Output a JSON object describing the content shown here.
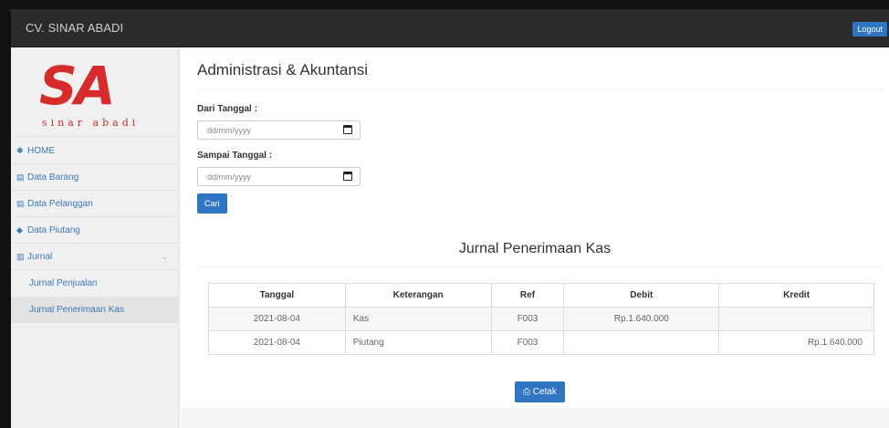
{
  "topbar": {
    "brand": "CV. SINAR ABADI",
    "logout_label": "Logout"
  },
  "logo": {
    "mark": "SA",
    "tagline": "sinar abadi"
  },
  "sidebar": {
    "items": [
      {
        "icon": "home-icon",
        "glyph": "✱",
        "label": "HOME"
      },
      {
        "icon": "document-icon",
        "glyph": "▤",
        "label": "Data Barang"
      },
      {
        "icon": "document-icon",
        "glyph": "▤",
        "label": "Data Pelanggan"
      },
      {
        "icon": "database-icon",
        "glyph": "◆",
        "label": "Data Piutang"
      },
      {
        "icon": "chart-icon",
        "glyph": "▥",
        "label": "Jurnal"
      }
    ],
    "sub_items": [
      {
        "label": "Jurnal Penjualan",
        "active": false
      },
      {
        "label": "Jurnal Penerimaan Kas",
        "active": true
      }
    ]
  },
  "main": {
    "title": "Administrasi & Akuntansi",
    "from_label": "Dari Tanggal :",
    "from_placeholder": "dd/mm/yyyy",
    "to_label": "Sampai Tanggal :",
    "to_placeholder": "dd/mm/yyyy",
    "search_label": "Cari",
    "section_title": "Jurnal Penerimaan Kas",
    "print_label": "Cetak",
    "colors": {
      "primary": "#2f75c2",
      "topbar": "#2b2b2b",
      "logo": "#d62b2b"
    }
  },
  "table": {
    "headers": [
      "Tanggal",
      "Keterangan",
      "Ref",
      "Debit",
      "Kredit"
    ],
    "rows": [
      [
        "2021-08-04",
        "Kas",
        "F003",
        "Rp.1.640.000",
        ""
      ],
      [
        "2021-08-04",
        "Piutang",
        "F003",
        "",
        "Rp.1.640.000"
      ]
    ]
  }
}
